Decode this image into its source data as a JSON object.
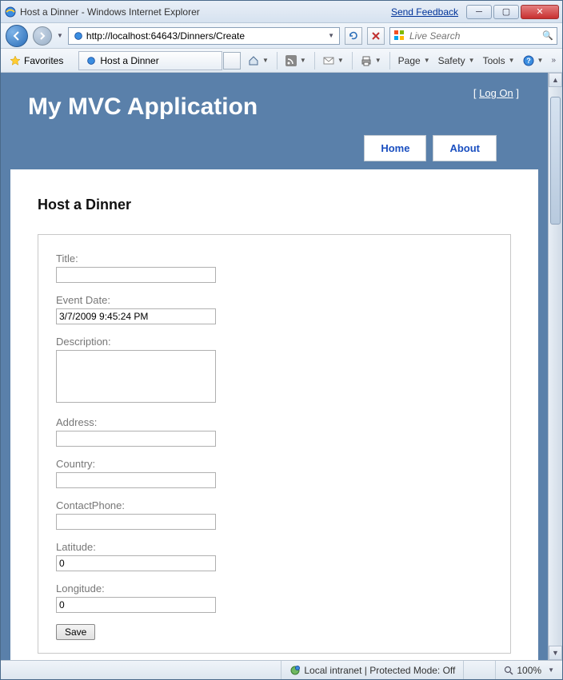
{
  "window": {
    "title": "Host a Dinner - Windows Internet Explorer",
    "feedback": "Send Feedback"
  },
  "address": {
    "url": "http://localhost:64643/Dinners/Create"
  },
  "search": {
    "placeholder": "Live Search"
  },
  "favorites_label": "Favorites",
  "tab_title": "Host a Dinner",
  "menus": {
    "page": "Page",
    "safety": "Safety",
    "tools": "Tools"
  },
  "mvc": {
    "app_title": "My MVC Application",
    "logon_label": "Log On",
    "nav": {
      "home": "Home",
      "about": "About"
    },
    "heading": "Host a Dinner",
    "fields": {
      "title_label": "Title:",
      "title_value": "",
      "eventdate_label": "Event Date:",
      "eventdate_value": "3/7/2009 9:45:24 PM",
      "description_label": "Description:",
      "description_value": "",
      "address_label": "Address:",
      "address_value": "",
      "country_label": "Country:",
      "country_value": "",
      "phone_label": "ContactPhone:",
      "phone_value": "",
      "latitude_label": "Latitude:",
      "latitude_value": "0",
      "longitude_label": "Longitude:",
      "longitude_value": "0"
    },
    "save_label": "Save"
  },
  "status": {
    "zone": "Local intranet | Protected Mode: Off",
    "zoom": "100%"
  }
}
